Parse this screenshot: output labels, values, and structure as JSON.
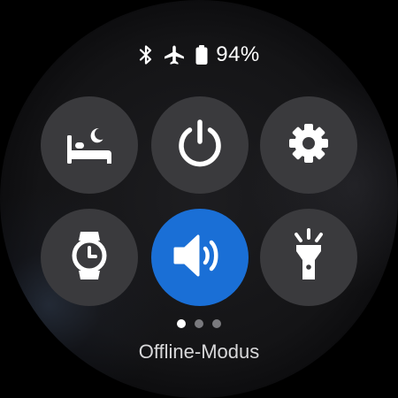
{
  "status_bar": {
    "icons": [
      "bluetooth-icon",
      "airplane-icon",
      "battery-icon"
    ],
    "battery_percent": "94%",
    "battery_level": 0.94
  },
  "tiles": [
    {
      "name": "bedtime-mode",
      "icon": "bed-moon-icon",
      "active": false
    },
    {
      "name": "power",
      "icon": "power-icon",
      "active": false
    },
    {
      "name": "settings",
      "icon": "gear-icon",
      "active": false
    },
    {
      "name": "watch-only",
      "icon": "watch-icon",
      "active": false
    },
    {
      "name": "sound",
      "icon": "speaker-icon",
      "active": true
    },
    {
      "name": "flashlight",
      "icon": "flashlight-icon",
      "active": false
    }
  ],
  "pager": {
    "pages": 3,
    "current": 1
  },
  "mode_label": "Offline-Modus",
  "colors": {
    "active_tile": "#1a6fd6",
    "tile": "#3a3a3d",
    "background": "#141416",
    "text": "#ffffff"
  }
}
